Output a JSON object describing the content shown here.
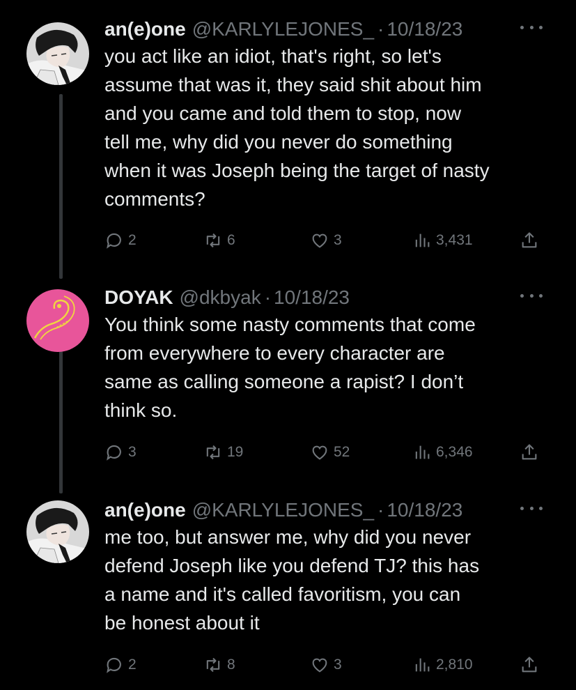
{
  "tweets": [
    {
      "name": "an(e)one",
      "handle": "@KARLYLEJONES_",
      "date": "10/18/23",
      "text": "you act like an idiot, that's right, so let's\nassume that was it, they said shit about him\nand you came and told them to stop, now\ntell me, why did you never do something\nwhen it was Joseph being the target of nasty\ncomments?",
      "replies": "2",
      "retweets": "6",
      "likes": "3",
      "views": "3,431",
      "avatar": "manga-portrait-avatar"
    },
    {
      "name": "DOYAK",
      "handle": "@dkbyak",
      "date": "10/18/23",
      "text": "You think some nasty comments that come\nfrom everywhere to every character are\nsame as calling someone a rapist? I don’t\nthink so.",
      "replies": "3",
      "retweets": "19",
      "likes": "52",
      "views": "6,346",
      "avatar": "pink-snake-avatar"
    },
    {
      "name": "an(e)one",
      "handle": "@KARLYLEJONES_",
      "date": "10/18/23",
      "text": "me too, but answer me, why did you never\ndefend Joseph like you defend TJ?  this has\na name and it's called favoritism, you can\nbe honest about it",
      "replies": "2",
      "retweets": "8",
      "likes": "3",
      "views": "2,810",
      "avatar": "manga-portrait-avatar"
    }
  ],
  "icons": {
    "reply": "reply-icon",
    "retweet": "retweet-icon",
    "like": "heart-icon",
    "views": "views-icon",
    "share": "share-icon",
    "more": "more-icon"
  },
  "colors": {
    "background": "#000000",
    "text": "#e7e9ea",
    "muted": "#71767b",
    "thread_line": "#333639",
    "avatar_pink": "#e8559a",
    "avatar_yellow": "#f0d640"
  }
}
